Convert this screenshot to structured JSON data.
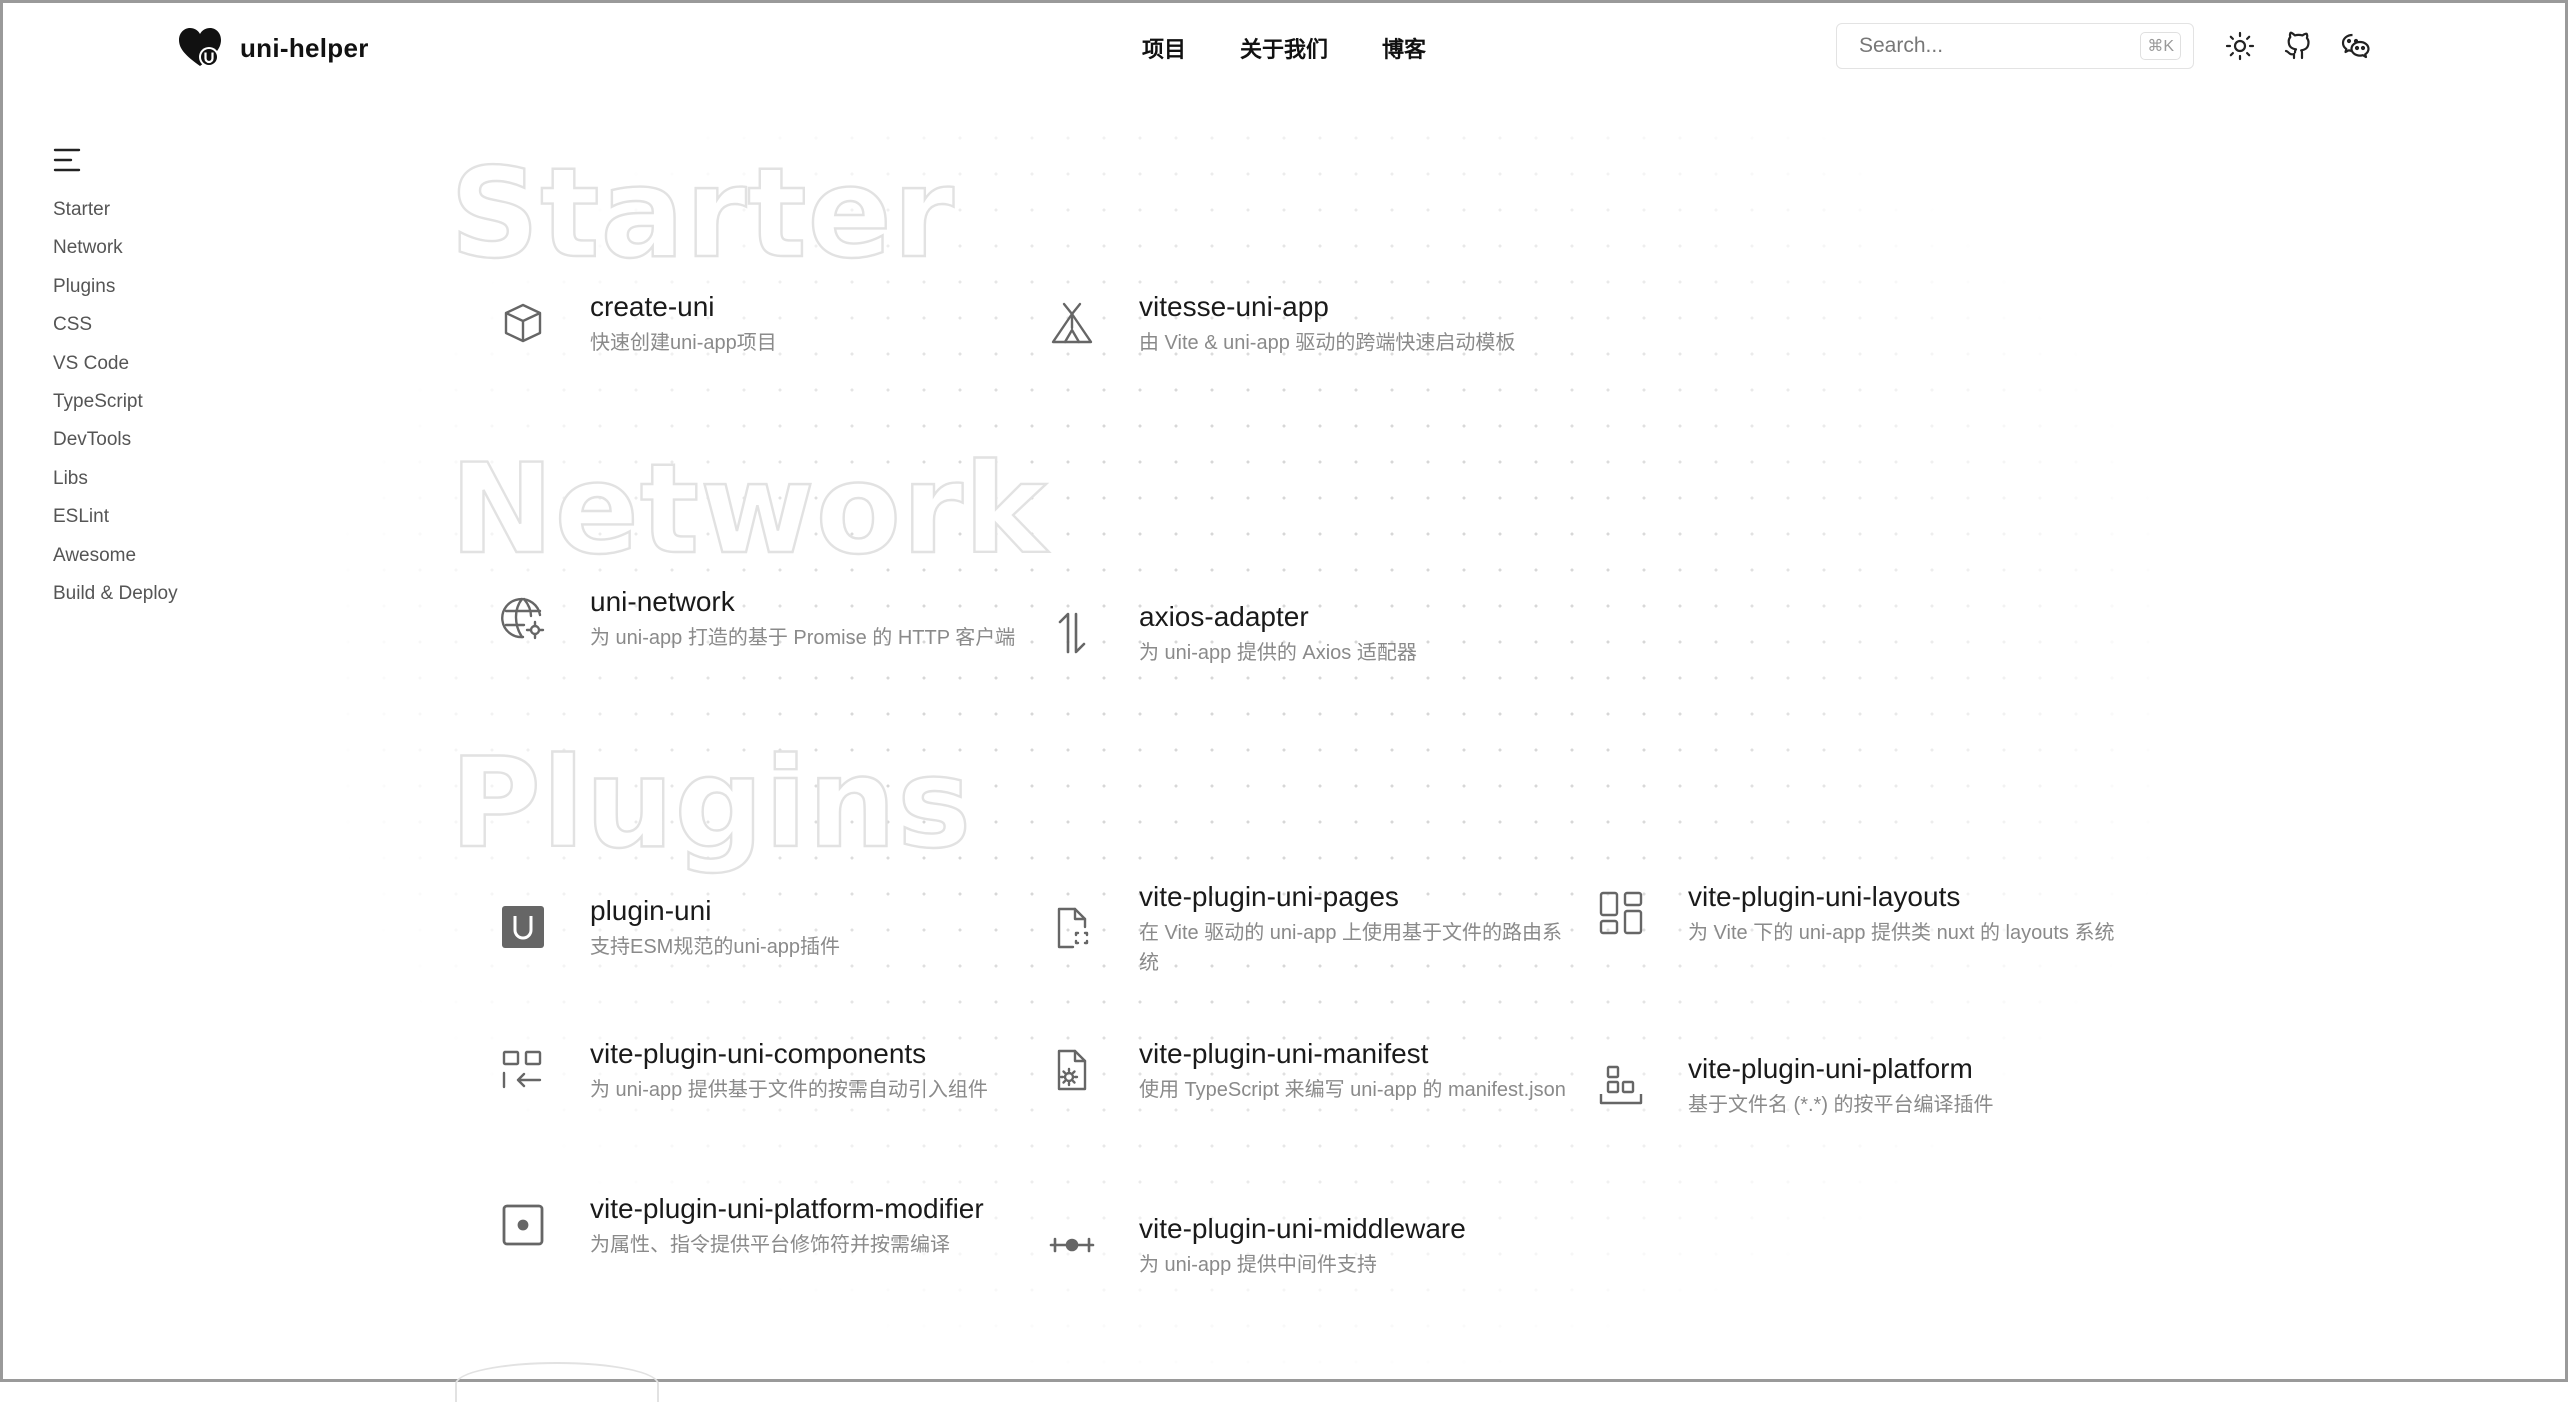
{
  "header": {
    "brand": "uni-helper",
    "nav": [
      "项目",
      "关于我们",
      "博客"
    ],
    "search": {
      "placeholder": "Search...",
      "shortcut": "⌘K"
    },
    "icons": [
      "sun-icon",
      "github-icon",
      "wechat-icon"
    ]
  },
  "sidebar": {
    "items": [
      "Starter",
      "Network",
      "Plugins",
      "CSS",
      "VS Code",
      "TypeScript",
      "DevTools",
      "Libs",
      "ESLint",
      "Awesome",
      "Build & Deploy"
    ]
  },
  "sections": [
    {
      "title": "Starter",
      "projects": [
        {
          "name": "create-uni",
          "desc": "快速创建uni-app项目",
          "icon": "box-icon"
        },
        {
          "name": "vitesse-uni-app",
          "desc": "由 Vite & uni-app 驱动的跨端快速启动模板",
          "icon": "tent-icon"
        }
      ]
    },
    {
      "title": "Network",
      "projects": [
        {
          "name": "uni-network",
          "desc": "为 uni-app 打造的基于 Promise 的 HTTP 客户端",
          "icon": "globe-icon"
        },
        {
          "name": "axios-adapter",
          "desc": "为 uni-app 提供的 Axios 适配器",
          "icon": "arrows-up-down-icon"
        }
      ]
    },
    {
      "title": "Plugins",
      "projects": [
        {
          "name": "plugin-uni",
          "desc": "支持ESM规范的uni-app插件",
          "icon": "u-square-icon"
        },
        {
          "name": "vite-plugin-uni-pages",
          "desc": "在 Vite 驱动的 uni-app 上使用基于文件的路由系统",
          "icon": "file-dashed-icon"
        },
        {
          "name": "vite-plugin-uni-layouts",
          "desc": "为 Vite 下的 uni-app 提供类 nuxt 的 layouts 系统",
          "icon": "layout-grid-icon"
        },
        {
          "name": "vite-plugin-uni-components",
          "desc": "为 uni-app 提供基于文件的按需自动引入组件",
          "icon": "components-import-icon"
        },
        {
          "name": "vite-plugin-uni-manifest",
          "desc": "使用 TypeScript 来编写 uni-app 的 manifest.json",
          "icon": "file-gear-icon"
        },
        {
          "name": "vite-plugin-uni-platform",
          "desc": "基于文件名 (*.*) 的按平台编译插件",
          "icon": "platform-blocks-icon"
        },
        {
          "name": "vite-plugin-uni-platform-modifier",
          "desc": "为属性、指令提供平台修饰符并按需编译",
          "icon": "dot-square-icon"
        },
        {
          "name": "vite-plugin-uni-middleware",
          "desc": "为 uni-app 提供中间件支持",
          "icon": "middleware-icon"
        }
      ]
    }
  ]
}
